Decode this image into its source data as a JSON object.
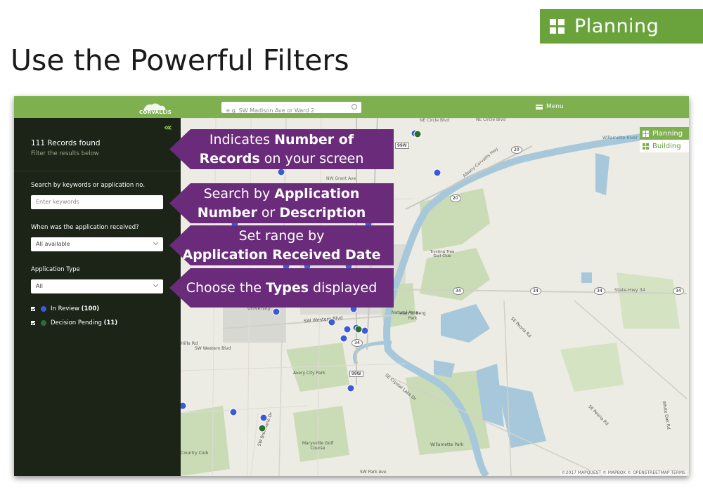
{
  "badge": {
    "label": "Planning"
  },
  "slide_title": "Use the Powerful Filters",
  "app": {
    "logo_text": "CORVALLIS",
    "search_placeholder": "e.g. SW Madison Ave or Ward 2",
    "menu_label": "Menu"
  },
  "sidebar": {
    "collapse_glyph": "«",
    "records_found": "111 Records found",
    "filter_hint": "Filter the results below",
    "keyword_label": "Search by keywords or application no.",
    "keyword_placeholder": "Enter keywords",
    "date_label": "When was the application received?",
    "date_value": "All available",
    "type_label": "Application Type",
    "type_value": "All",
    "statuses": [
      {
        "label": "In Review",
        "count": "(100)",
        "color": "#3b5bd6"
      },
      {
        "label": "Decision Pending",
        "count": "(11)",
        "color": "#2c6e2f"
      }
    ]
  },
  "layers": [
    {
      "label": "Planning",
      "active": true
    },
    {
      "label": "Building",
      "active": false
    }
  ],
  "map_labels": {
    "ne_circle": "NE Circle Blvd",
    "ne_circle2": "NE Circle Blvd",
    "nw_grant": "NW Grant Ave",
    "albany": "Albany-Corvallis Hwy",
    "state_hwy": "State-Hwy 34",
    "sw_western": "SW Western Blvd",
    "hills": "Hills Rd",
    "sw_western2": "SW Western Blvd",
    "avery": "Avery City Park",
    "alan": "Alan B. Berg Park",
    "trysting": "Trysting Tree Golf Club",
    "willamette": "Willamette Park",
    "marysville": "Marysville Golf Course",
    "country": "Country Club",
    "sw_park": "SW Park Ave",
    "se_peoria": "SE Peoria Rd",
    "se_peoria2": "SE Peoria Rd",
    "se_crystal": "SE Crystal Lake Dr",
    "white_oak": "White Oak Rd",
    "sw_brooklane": "SW Brooklane Dr",
    "university": "University",
    "willamette_river": "Willamette River",
    "natural_area": "Natural Area"
  },
  "route_shields": [
    "99W",
    "20",
    "20",
    "34",
    "34",
    "34",
    "34",
    "99W",
    "34"
  ],
  "attribution": "©2017 MAPQUEST  © MAPBOX  © OPENSTREETMAP  TERMS",
  "callouts": {
    "records": {
      "l1_pre": "Indicates ",
      "l1_b": "Number of",
      "l2_b": "Records",
      "l2_post": " on your screen"
    },
    "search": {
      "l1_pre": "Search by ",
      "l1_b": "Application",
      "l2_b": "Number",
      "l2_mid": " or ",
      "l2_b2": "Description"
    },
    "date": {
      "l1": "Set range by",
      "l2_b": "Application Received Date"
    },
    "types": {
      "pre": "Choose the ",
      "b": "Types",
      "post": " displayed"
    }
  },
  "colors": {
    "brand_green": "#6aa33c",
    "topbar_green": "#7fb04f",
    "sidebar": "#1b2417",
    "callout": "#6a2c7a",
    "in_review": "#3b5bd6",
    "decision_pending": "#2c6e2f",
    "river": "#a6c8da",
    "park": "#c9dcb5"
  }
}
